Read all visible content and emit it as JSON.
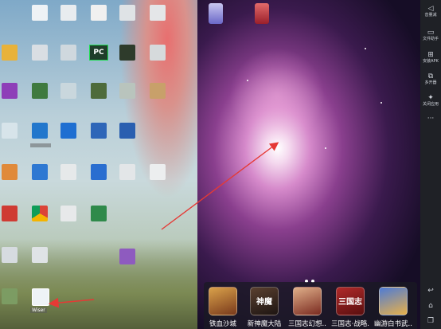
{
  "desktop": {
    "pc_icon_label": "PC",
    "selected_icon_label": "Wiser"
  },
  "emulator": {
    "dock": [
      {
        "label": "铁血沙城",
        "icon_text": "",
        "icon": "iron-blood-sand-city-icon",
        "color": "#a8632f"
      },
      {
        "label": "新神魔大陆",
        "icon_text": "神魔",
        "icon": "new-god-demon-continent-icon",
        "color": "#3a2a24"
      },
      {
        "label": "三国志幻想...",
        "icon_text": "",
        "icon": "three-kingdoms-fantasy-icon",
        "color": "#7a2a20"
      },
      {
        "label": "三国志·战略...",
        "icon_text": "三国志",
        "icon": "three-kingdoms-strategy-icon",
        "color": "#8b1c1c"
      },
      {
        "label": "幽游白书武...",
        "icon_text": "",
        "icon": "yu-yu-hakusho-icon",
        "color": "#2b4f9a"
      }
    ]
  },
  "sidebar": {
    "items": [
      {
        "label": "音量减",
        "icon": "volume-down-icon",
        "glyph": "◁"
      },
      {
        "label": "文件助手",
        "icon": "file-assistant-icon",
        "glyph": "▭"
      },
      {
        "label": "安装APK",
        "icon": "install-apk-icon",
        "glyph": "⊞"
      },
      {
        "label": "多开器",
        "icon": "multi-instance-icon",
        "glyph": "⧉"
      },
      {
        "label": "关闭应用",
        "icon": "close-app-icon",
        "glyph": "✦"
      },
      {
        "label": "",
        "icon": "more-icon",
        "glyph": "···"
      }
    ],
    "bottom": [
      {
        "icon": "back-icon",
        "glyph": "↩"
      },
      {
        "icon": "home-icon",
        "glyph": "⌂"
      },
      {
        "icon": "recent-apps-icon",
        "glyph": "❐"
      }
    ]
  },
  "colors": {
    "arrow": "#e53935",
    "sidebar_bg": "#1f2126"
  }
}
